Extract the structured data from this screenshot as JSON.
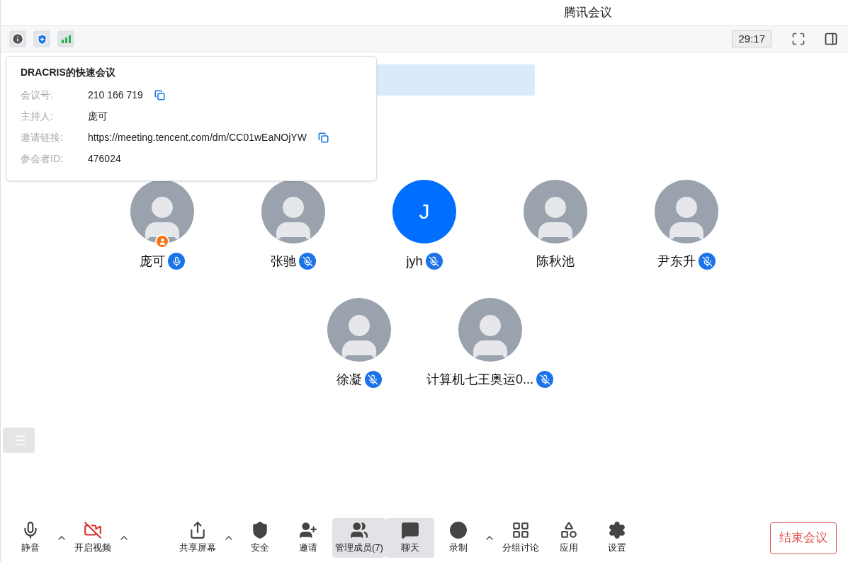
{
  "window": {
    "title": "腾讯会议"
  },
  "top_bar": {
    "timer": "29:17"
  },
  "info_popover": {
    "title": "DRACRIS的快速会议",
    "fields": [
      {
        "label": "会议号:",
        "value": "210 166 719",
        "copyable": true
      },
      {
        "label": "主持人:",
        "value": "庞可",
        "copyable": false
      },
      {
        "label": "邀请链接:",
        "value": "https://meeting.tencent.com/dm/CC01wEaNOjYW",
        "copyable": true
      },
      {
        "label": "参会者ID:",
        "value": "476024",
        "copyable": false
      }
    ]
  },
  "participants": [
    {
      "name": "庞可",
      "kind": "photo",
      "muted": false,
      "host": true
    },
    {
      "name": "张驰",
      "kind": "photo",
      "muted": true,
      "host": false
    },
    {
      "name": "jyh",
      "kind": "letter",
      "initial": "J",
      "muted": true,
      "host": false
    },
    {
      "name": "陈秋池",
      "kind": "photo",
      "host": false
    },
    {
      "name": "尹东升",
      "kind": "photo",
      "muted": true,
      "host": false
    },
    {
      "name": "徐凝",
      "kind": "photo",
      "muted": true,
      "host": false
    },
    {
      "name": "计算机七王奥运0...",
      "kind": "photo",
      "muted": true,
      "host": false
    }
  ],
  "toolbar": [
    {
      "label": "静音",
      "selected": false,
      "caret": true
    },
    {
      "label": "开启视频",
      "selected": false,
      "caret": true
    },
    {
      "label": "共享屏幕",
      "selected": false,
      "caret": true
    },
    {
      "label": "安全",
      "selected": false,
      "caret": false
    },
    {
      "label": "邀请",
      "selected": false,
      "caret": false
    },
    {
      "label": "管理成员(7)",
      "selected": true,
      "caret": false
    },
    {
      "label": "聊天",
      "selected": true,
      "caret": false
    },
    {
      "label": "录制",
      "selected": false,
      "caret": true
    },
    {
      "label": "分组讨论",
      "selected": false,
      "caret": false
    },
    {
      "label": "应用",
      "selected": false,
      "caret": false
    },
    {
      "label": "设置",
      "selected": false,
      "caret": false
    }
  ],
  "end_button": "结束会议"
}
